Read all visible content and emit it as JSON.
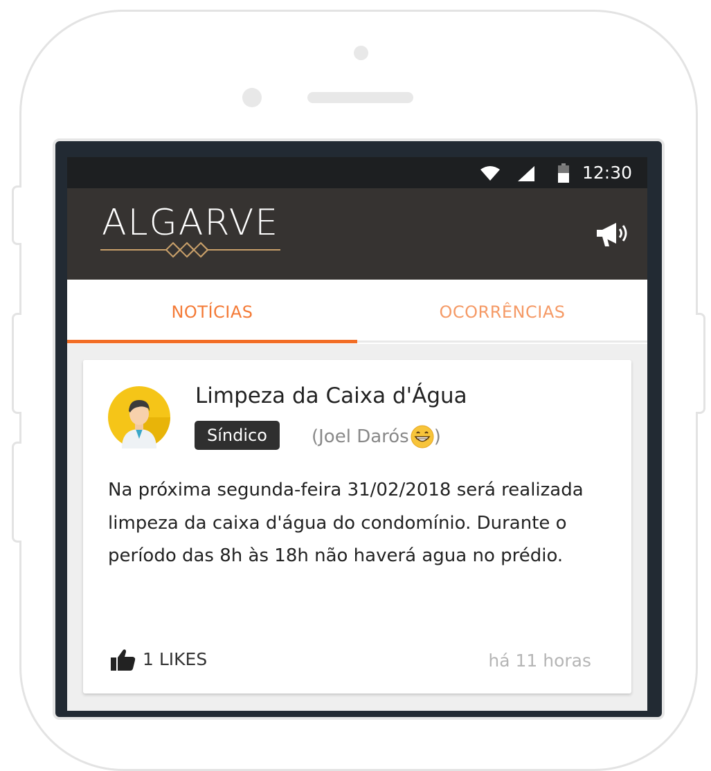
{
  "status_bar": {
    "time": "12:30"
  },
  "app_bar": {
    "logo": "ALGARVE"
  },
  "tabs": [
    {
      "label": "NOTÍCIAS",
      "active": true
    },
    {
      "label": "OCORRÊNCIAS",
      "active": false
    }
  ],
  "post": {
    "title": "Limpeza da Caixa d'Água",
    "role_badge": "Síndico",
    "author": "(Joel Darós",
    "author_end": ")",
    "body": "Na próxima segunda-feira 31/02/2018 será realizada limpeza da caixa d'água do condomínio. Durante o período das 8h às 18h não haverá agua no prédio.",
    "likes": "1 LIKES",
    "time_ago": "há 11 horas"
  },
  "colors": {
    "accent": "#f26d25",
    "app_bar": "#363331",
    "status_bar": "#1d1f21",
    "badge": "#2f2f2f"
  }
}
